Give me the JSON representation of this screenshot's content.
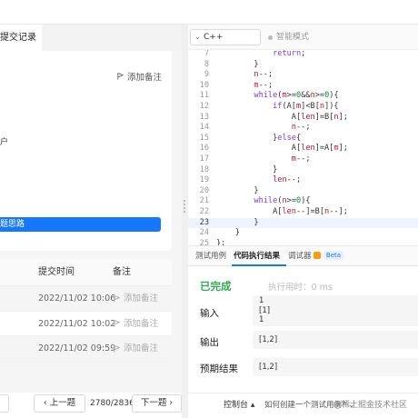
{
  "left_panel": {
    "tab_label": "提交记录",
    "add_note_label": "添加备注",
    "user_fragment": "户",
    "blue_button_label": "题思路",
    "table": {
      "headers": [
        "提交时间",
        "备注"
      ],
      "rows": [
        {
          "time": "2022/11/02 10:06",
          "note": "添加备注"
        },
        {
          "time": "2022/11/02 10:02",
          "note": "添加备注"
        },
        {
          "time": "2022/11/02 09:59",
          "note": "添加备注"
        }
      ]
    }
  },
  "footer": {
    "prev_label": "上一题",
    "counter": "2780/2836",
    "next_label": "下一题",
    "console_label": "控制台",
    "how_link": "如何创建一个测试用例?",
    "watermark": "@稀土掘金技术社区"
  },
  "editor": {
    "language": "C++",
    "smart_mode_label": "智能模式",
    "lines": [
      {
        "n": "7",
        "code": "            return;"
      },
      {
        "n": "8",
        "code": "        }"
      },
      {
        "n": "9",
        "code": "        n--;"
      },
      {
        "n": "10",
        "code": "        m--;"
      },
      {
        "n": "11",
        "code": "        while(m>=0&&n>=0){"
      },
      {
        "n": "12",
        "code": "            if(A[m]<B[n]){"
      },
      {
        "n": "13",
        "code": "                A[len]=B[n];"
      },
      {
        "n": "14",
        "code": "                n--;"
      },
      {
        "n": "15",
        "code": "            }else{"
      },
      {
        "n": "16",
        "code": "                A[len]=A[m];"
      },
      {
        "n": "17",
        "code": "                m--;"
      },
      {
        "n": "18",
        "code": "            }"
      },
      {
        "n": "19",
        "code": "            len--;"
      },
      {
        "n": "20",
        "code": "        }"
      },
      {
        "n": "21",
        "code": "        while(n>=0){"
      },
      {
        "n": "22",
        "code": "            A[len--]=B[n--];"
      },
      {
        "n": "23",
        "code": "        }"
      },
      {
        "n": "24",
        "code": "    }"
      },
      {
        "n": "25",
        "code": "};"
      }
    ],
    "active_line": "23"
  },
  "console": {
    "tabs": [
      "测试用例",
      "代码执行结果",
      "调试器"
    ],
    "beta_label": "Beta",
    "status": "已完成",
    "runtime": "执行用时：0 ms",
    "input_label": "输入",
    "input_lines": [
      "1",
      "[1]",
      "1"
    ],
    "output_label": "输出",
    "output_value": "[1,2]",
    "expected_label": "预期结果",
    "expected_value": "[1,2]"
  }
}
